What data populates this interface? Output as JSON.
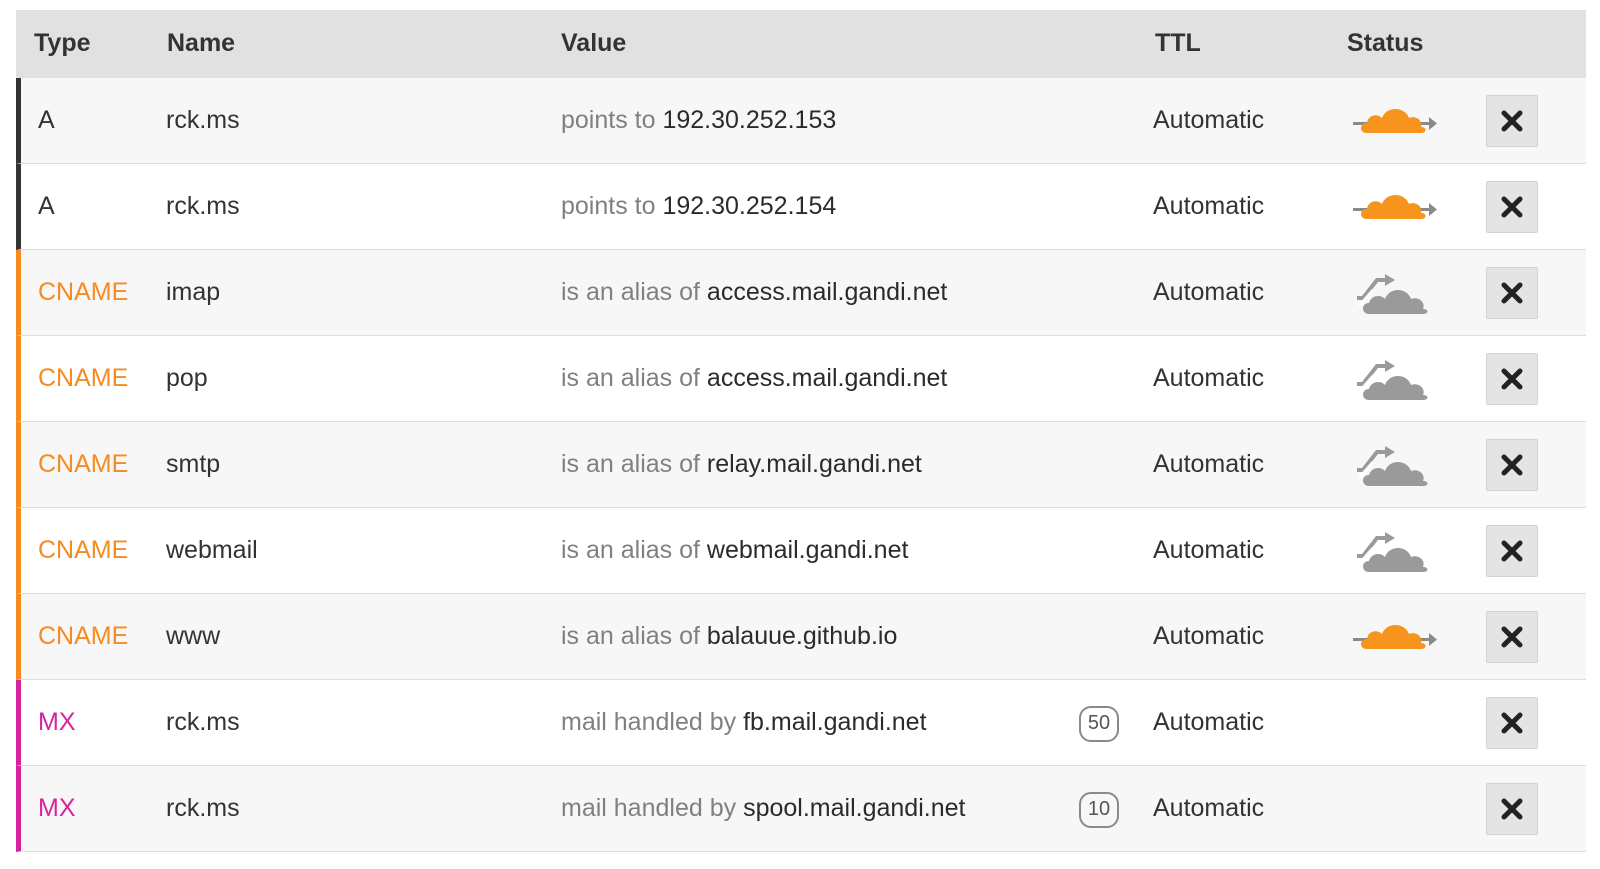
{
  "colors": {
    "A": "#333333",
    "CNAME": "#f68b1f",
    "MX": "#d6249f",
    "proxied_cloud": "#f7941e",
    "dns_only_cloud": "#9a9a9a"
  },
  "headers": {
    "type": "Type",
    "name": "Name",
    "value": "Value",
    "ttl": "TTL",
    "status": "Status"
  },
  "records": [
    {
      "type": "A",
      "name": "rck.ms",
      "value_prefix": "points to",
      "value_target": "192.30.252.153",
      "priority": null,
      "ttl": "Automatic",
      "status_icon": "proxied-cloud-icon",
      "delete_icon": "close-icon"
    },
    {
      "type": "A",
      "name": "rck.ms",
      "value_prefix": "points to",
      "value_target": "192.30.252.154",
      "priority": null,
      "ttl": "Automatic",
      "status_icon": "proxied-cloud-icon",
      "delete_icon": "close-icon"
    },
    {
      "type": "CNAME",
      "name": "imap",
      "value_prefix": "is an alias of",
      "value_target": "access.mail.gandi.net",
      "priority": null,
      "ttl": "Automatic",
      "status_icon": "dns-only-cloud-icon",
      "delete_icon": "close-icon"
    },
    {
      "type": "CNAME",
      "name": "pop",
      "value_prefix": "is an alias of",
      "value_target": "access.mail.gandi.net",
      "priority": null,
      "ttl": "Automatic",
      "status_icon": "dns-only-cloud-icon",
      "delete_icon": "close-icon"
    },
    {
      "type": "CNAME",
      "name": "smtp",
      "value_prefix": "is an alias of",
      "value_target": "relay.mail.gandi.net",
      "priority": null,
      "ttl": "Automatic",
      "status_icon": "dns-only-cloud-icon",
      "delete_icon": "close-icon"
    },
    {
      "type": "CNAME",
      "name": "webmail",
      "value_prefix": "is an alias of",
      "value_target": "webmail.gandi.net",
      "priority": null,
      "ttl": "Automatic",
      "status_icon": "dns-only-cloud-icon",
      "delete_icon": "close-icon"
    },
    {
      "type": "CNAME",
      "name": "www",
      "value_prefix": "is an alias of",
      "value_target": "balauue.github.io",
      "priority": null,
      "ttl": "Automatic",
      "status_icon": "proxied-cloud-icon",
      "delete_icon": "close-icon"
    },
    {
      "type": "MX",
      "name": "rck.ms",
      "value_prefix": "mail handled by",
      "value_target": "fb.mail.gandi.net",
      "priority": "50",
      "ttl": "Automatic",
      "status_icon": null,
      "delete_icon": "close-icon"
    },
    {
      "type": "MX",
      "name": "rck.ms",
      "value_prefix": "mail handled by",
      "value_target": "spool.mail.gandi.net",
      "priority": "10",
      "ttl": "Automatic",
      "status_icon": null,
      "delete_icon": "close-icon"
    }
  ]
}
